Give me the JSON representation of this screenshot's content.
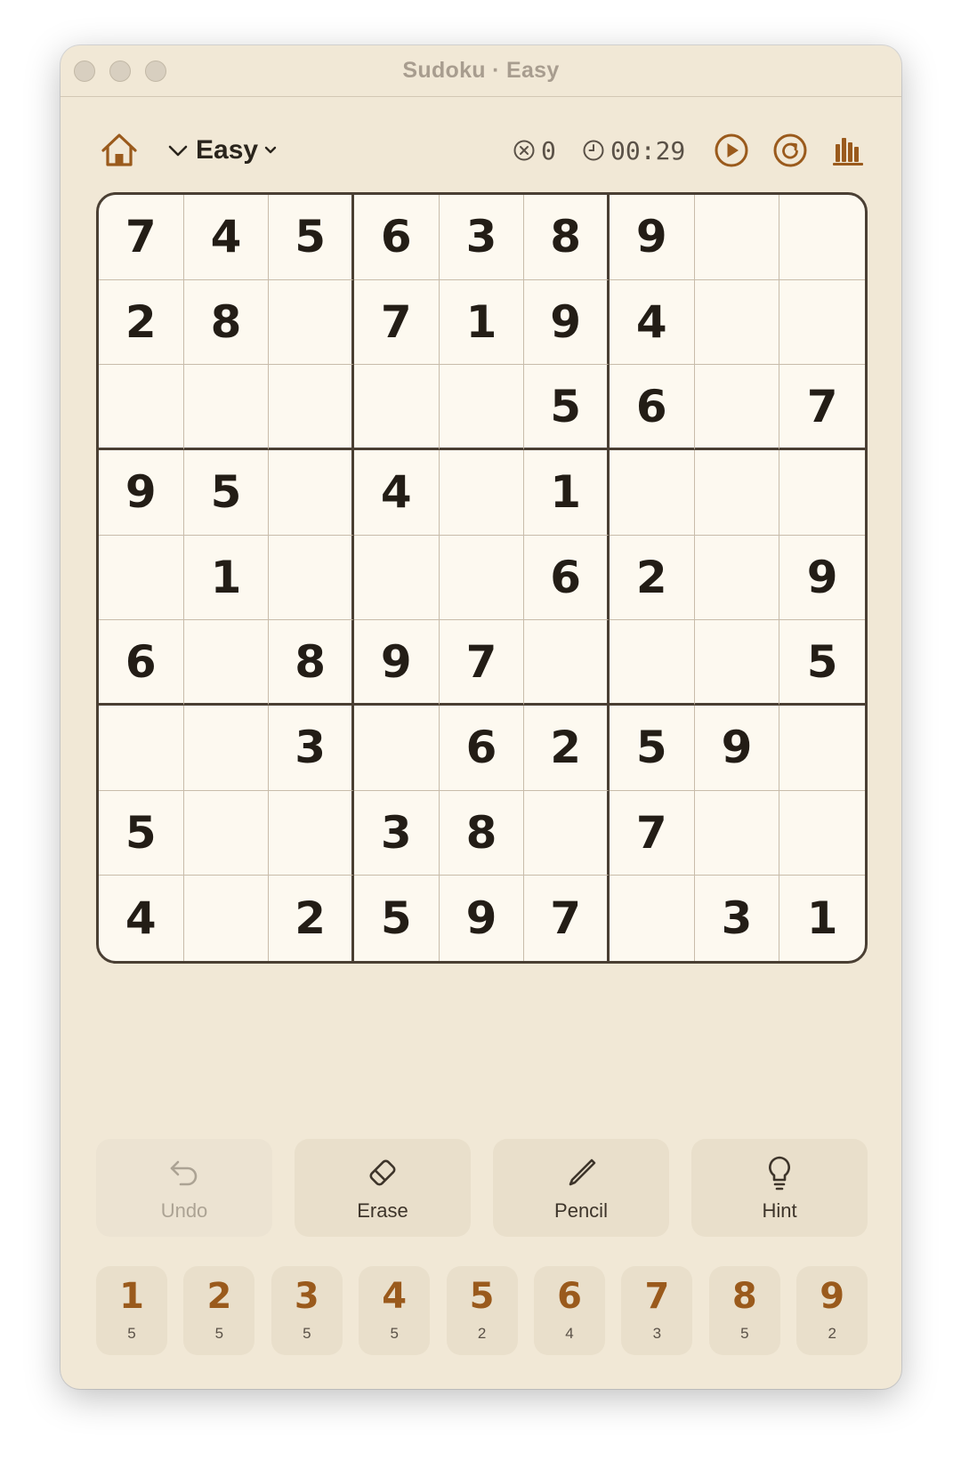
{
  "window": {
    "title": "Sudoku · Easy"
  },
  "toolbar": {
    "difficulty": "Easy",
    "mistakes": "0",
    "timer": "00:29"
  },
  "board": [
    [
      "7",
      "4",
      "5",
      "6",
      "3",
      "8",
      "9",
      "",
      ""
    ],
    [
      "2",
      "8",
      "",
      "7",
      "1",
      "9",
      "4",
      "",
      ""
    ],
    [
      "",
      "",
      "",
      "",
      "",
      "5",
      "6",
      "",
      "7"
    ],
    [
      "9",
      "5",
      "",
      "4",
      "",
      "1",
      "",
      "",
      ""
    ],
    [
      "",
      "1",
      "",
      "",
      "",
      "6",
      "2",
      "",
      "9"
    ],
    [
      "6",
      "",
      "8",
      "9",
      "7",
      "",
      "",
      "",
      "5"
    ],
    [
      "",
      "",
      "3",
      "",
      "6",
      "2",
      "5",
      "9",
      ""
    ],
    [
      "5",
      "",
      "",
      "3",
      "8",
      "",
      "7",
      "",
      ""
    ],
    [
      "4",
      "",
      "2",
      "5",
      "9",
      "7",
      "",
      "3",
      "1"
    ]
  ],
  "actions": {
    "undo": "Undo",
    "erase": "Erase",
    "pencil": "Pencil",
    "hint": "Hint"
  },
  "numpad": [
    {
      "digit": "1",
      "remaining": "5"
    },
    {
      "digit": "2",
      "remaining": "5"
    },
    {
      "digit": "3",
      "remaining": "5"
    },
    {
      "digit": "4",
      "remaining": "5"
    },
    {
      "digit": "5",
      "remaining": "2"
    },
    {
      "digit": "6",
      "remaining": "4"
    },
    {
      "digit": "7",
      "remaining": "3"
    },
    {
      "digit": "8",
      "remaining": "5"
    },
    {
      "digit": "9",
      "remaining": "2"
    }
  ],
  "colors": {
    "background": "#f1e8d6",
    "board": "#fdf9f0",
    "accent": "#9a5a1c",
    "text": "#231d16"
  },
  "icons": {
    "home": "home-icon",
    "difficulty": "chevron-down-icon",
    "mistakes": "x-circle-icon",
    "timer": "clock-icon",
    "play": "play-icon",
    "restart": "restart-icon",
    "stats": "bar-chart-icon",
    "undo": "undo-icon",
    "erase": "eraser-icon",
    "pencil": "pencil-icon",
    "hint": "lightbulb-icon"
  }
}
